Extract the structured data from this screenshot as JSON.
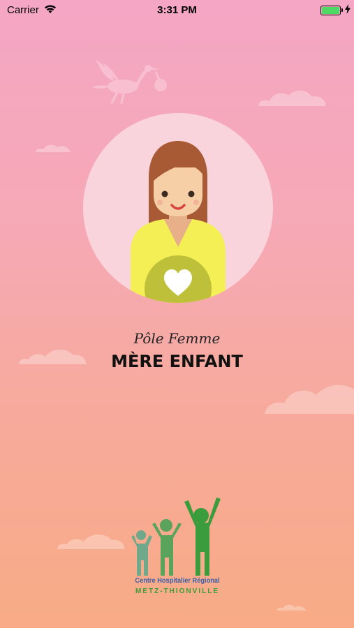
{
  "status_bar": {
    "carrier": "Carrier",
    "time": "3:31 PM",
    "battery_level": 1.0
  },
  "splash": {
    "subtitle": "Pôle Femme",
    "title": "MÈRE ENFANT"
  },
  "logo": {
    "line1": "Centre Hospitalier Régional",
    "line2": "METZ-THIONVILLE"
  },
  "colors": {
    "background_top": "#f4a6c4",
    "background_bottom": "#f8ab85",
    "avatar_circle": "#fad4dc",
    "sweater": "#f3ef55",
    "belly": "#bfc03a",
    "hair": "#a85a35",
    "logo_blue": "#3a5fa8",
    "logo_green": "#3a9c3a"
  },
  "icons": [
    "wifi-icon",
    "charging-bolt-icon",
    "stork-icon",
    "heart-icon",
    "cloud-icon"
  ]
}
